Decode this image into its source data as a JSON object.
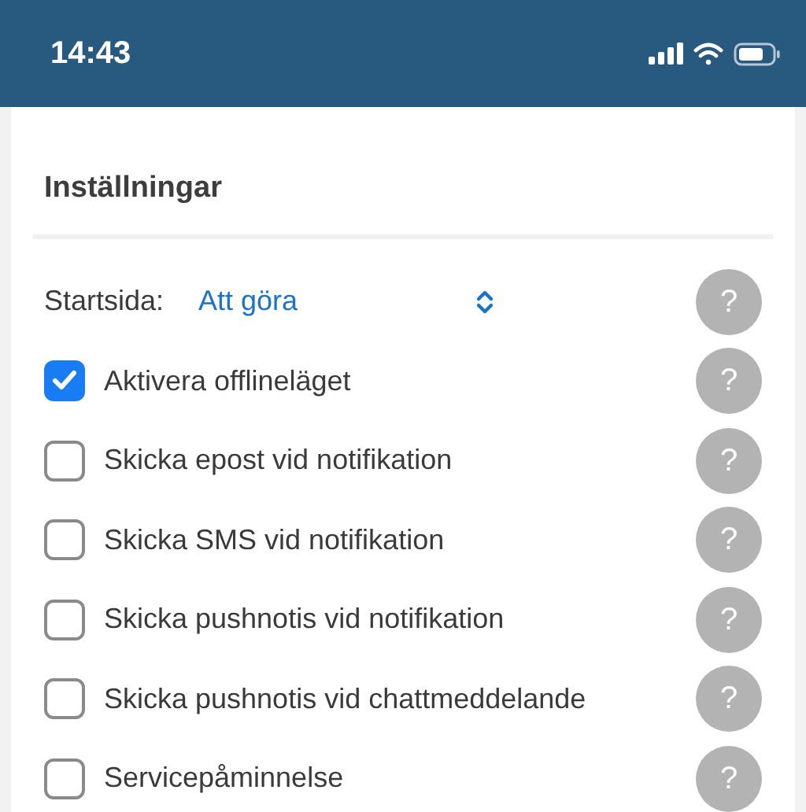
{
  "status_bar": {
    "time": "14:43"
  },
  "section": {
    "title": "Inställningar"
  },
  "settings": [
    {
      "kind": "select",
      "label": "Startsida:",
      "value": "Att göra",
      "help": "?"
    },
    {
      "kind": "checkbox",
      "label": "Aktivera offlineläget",
      "checked": true,
      "help": "?"
    },
    {
      "kind": "checkbox",
      "label": "Skicka epost vid notifikation",
      "checked": false,
      "help": "?"
    },
    {
      "kind": "checkbox",
      "label": "Skicka SMS vid notifikation",
      "checked": false,
      "help": "?"
    },
    {
      "kind": "checkbox",
      "label": "Skicka pushnotis vid notifikation",
      "checked": false,
      "help": "?"
    },
    {
      "kind": "checkbox",
      "label": "Skicka pushnotis vid chattmeddelande",
      "checked": false,
      "help": "?"
    },
    {
      "kind": "checkbox",
      "label": "Servicepåminnelse",
      "checked": false,
      "help": "?"
    }
  ]
}
